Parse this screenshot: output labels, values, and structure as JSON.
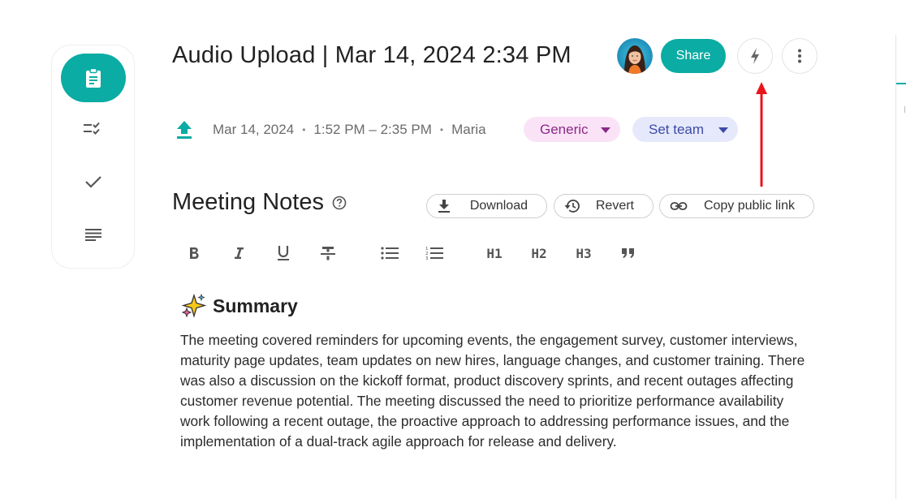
{
  "header": {
    "title": "Audio Upload | Mar 14, 2024 2:34 PM",
    "share_label": "Share"
  },
  "meta": {
    "date": "Mar 14, 2024",
    "time_range": "1:52 PM – 2:35 PM",
    "author": "Maria",
    "separator": "•"
  },
  "tags": {
    "category": "Generic",
    "team": "Set team"
  },
  "notes": {
    "title": "Meeting Notes",
    "download_label": "Download",
    "revert_label": "Revert",
    "copy_link_label": "Copy public link"
  },
  "toolbar": {
    "h1": "H1",
    "h2": "H2",
    "h3": "H3"
  },
  "summary": {
    "heading": "Summary",
    "body": "The meeting covered reminders for upcoming events, the engagement survey, customer interviews, maturity page updates, team updates on new hires, language changes, and customer training. There was also a discussion on the kickoff format, product discovery sprints, and recent outages affecting customer revenue potential. The meeting discussed the need to prioritize performance availability work following a recent outage, the proactive approach to addressing performance issues, and the implementation of a dual-track agile approach for release and delivery."
  },
  "icons": {
    "rail": [
      "clipboard-icon",
      "checklist-icon",
      "check-icon",
      "text-lines-icon"
    ],
    "header": [
      "avatar",
      "lightning-icon",
      "more-vertical-icon"
    ],
    "meta": [
      "upload-icon"
    ]
  },
  "colors": {
    "accent": "#0aaca3",
    "generic_tag_bg": "#fbe3f7",
    "generic_tag_fg": "#8a2a86",
    "team_tag_bg": "#e6e9fb",
    "team_tag_fg": "#3c4aa8",
    "annotation": "#e8151b"
  }
}
